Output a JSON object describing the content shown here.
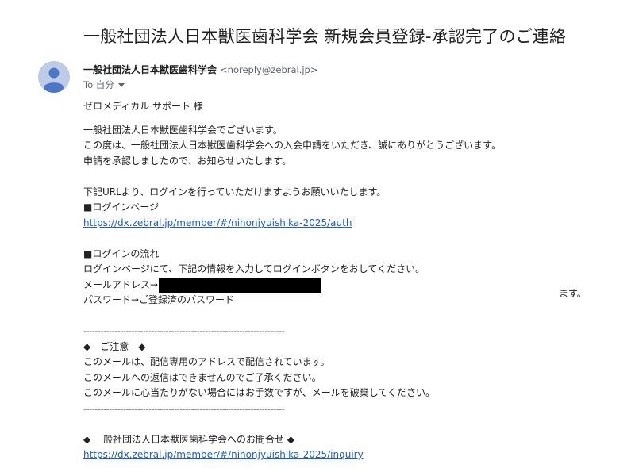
{
  "email": {
    "subject": "一般社団法人日本獣医歯科学会 新規会員登録-承認完了のご連絡",
    "sender_name": "一般社団法人日本獣医歯科学会",
    "sender_email": "<noreply@zebral.jp>",
    "recipient": "To 自分",
    "avatar_icon": "person-icon",
    "avatar_color": "#bccbe6"
  },
  "body": {
    "greeting": "ゼロメディカル サポート 様",
    "intro": [
      "一般社団法人日本獣医歯科学会でございます。",
      "この度は、一般社団法人日本獣医歯科学会への入会申請をいただき、誠にありがとうございます。",
      "申請を承認しましたので、お知らせいたします。"
    ],
    "login_request": "下記URLより、ログインを行っていただけますようお願いいたします。",
    "login_page_heading": "■ログインページ",
    "login_url": "https://dx.zebral.jp/member/#/nihonjyuishika-2025/auth",
    "flow_heading": "■ログインの流れ",
    "flow_text": "ログインページにて、下記の情報を入力してログインボタンをおしてください。",
    "email_label": "メールアドレス→",
    "stray_text": "ます。",
    "password_line": "パスワード→ご登録済のパスワード",
    "divider": "-----------------------------------------------------------------------",
    "notice_heading": "◆　ご注意　◆",
    "notice_lines": [
      "このメールは、配信専用のアドレスで配信されています。",
      "このメールへの返信はできませんのでご了承ください。",
      "このメールに心当たりがない場合にはお手数ですが、メールを破棄してください。"
    ],
    "inquiry_heading": "◆ 一般社団法人日本獣医歯科学会へのお問合せ ◆",
    "inquiry_url": "https://dx.zebral.jp/member/#/nihonjyuishika-2025/inquiry"
  },
  "colors": {
    "link": "#1a5cd8",
    "redaction": "#000000"
  }
}
